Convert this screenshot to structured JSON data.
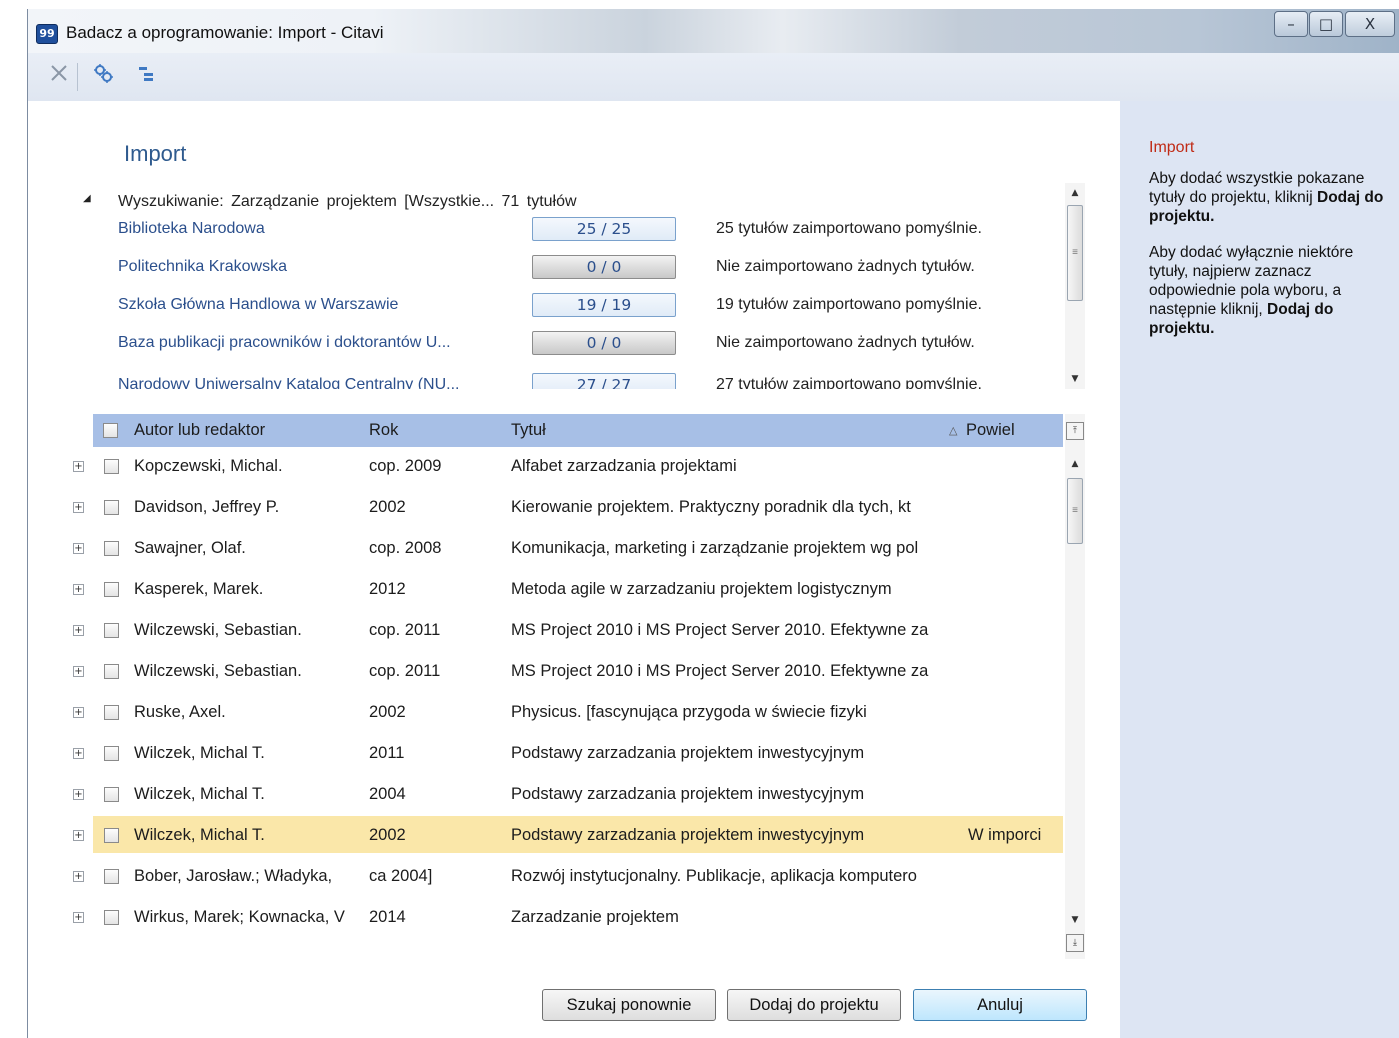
{
  "window": {
    "title": "Badacz a oprogramowanie: Import - Citavi",
    "app_icon_glyph": "99",
    "controls": {
      "minimize": "–",
      "maximize": "□",
      "close": "X"
    }
  },
  "toolbar": {
    "icons": [
      "close-x-icon",
      "gears-icon",
      "outline-icon"
    ]
  },
  "main": {
    "heading": "Import",
    "search": {
      "toggle_glyph": "◢",
      "label": "Wyszukiwanie: Zarządzanie projektem [Wszystkie... 71 tytułów"
    },
    "sources": [
      {
        "name": "Biblioteka Narodowa",
        "progress": "25 / 25",
        "status": "25 tytułów zaimportowano pomyślnie.",
        "ok": true
      },
      {
        "name": "Politechnika Krakowska",
        "progress": "0 / 0",
        "status": "Nie zaimportowano żadnych tytułów.",
        "ok": false
      },
      {
        "name": "Szkoła Główna Handlowa w Warszawie",
        "progress": "19 / 19",
        "status": "19 tytułów zaimportowano pomyślnie.",
        "ok": true
      },
      {
        "name": "Baza publikacji pracowników i doktorantów U...",
        "progress": "0 / 0",
        "status": "Nie zaimportowano żadnych tytułów.",
        "ok": false
      },
      {
        "name": "Narodowy Uniwersalny Katalog Centralny (NU...",
        "progress": "27 / 27",
        "status": "27 tytułów zaimportowano pomyślnie.",
        "ok": true
      }
    ],
    "grid": {
      "columns": {
        "author": "Autor lub redaktor",
        "year": "Rok",
        "title": "Tytuł",
        "duplicate": "Powiel",
        "sort_indicator": "△"
      },
      "rows": [
        {
          "author": "Kopczewski, Michal.",
          "year": "cop. 2009",
          "title": "Alfabet zarzadzania projektami",
          "duplicate": ""
        },
        {
          "author": "Davidson, Jeffrey P.",
          "year": "2002",
          "title": "Kierowanie projektem. Praktyczny poradnik dla tych, kt",
          "duplicate": ""
        },
        {
          "author": "Sawajner, Olaf.",
          "year": "cop. 2008",
          "title": "Komunikacja, marketing i zarządzanie projektem wg pol",
          "duplicate": ""
        },
        {
          "author": "Kasperek, Marek.",
          "year": "2012",
          "title": "Metoda agile w zarzadzaniu projektem logistycznym",
          "duplicate": ""
        },
        {
          "author": "Wilczewski, Sebastian.",
          "year": "cop. 2011",
          "title": "MS Project 2010 i MS Project Server 2010. Efektywne za",
          "duplicate": ""
        },
        {
          "author": "Wilczewski, Sebastian.",
          "year": "cop. 2011",
          "title": "MS Project 2010 i MS Project Server 2010. Efektywne za",
          "duplicate": ""
        },
        {
          "author": "Ruske, Axel.",
          "year": "2002",
          "title": "Physicus. [fascynująca przygoda w świecie fizyki",
          "duplicate": ""
        },
        {
          "author": "Wilczek, Michal T.",
          "year": "2011",
          "title": "Podstawy zarzadzania projektem inwestycyjnym",
          "duplicate": ""
        },
        {
          "author": "Wilczek, Michal T.",
          "year": "2004",
          "title": "Podstawy zarzadzania projektem inwestycyjnym",
          "duplicate": ""
        },
        {
          "author": "Wilczek, Michal T.",
          "year": "2002",
          "title": "Podstawy zarzadzania projektem inwestycyjnym",
          "duplicate": "W imporci",
          "highlighted": true
        },
        {
          "author": "Bober, Jarosław.; Władyka,",
          "year": "ca 2004]",
          "title": "Rozwój instytucjonalny. Publikacje, aplikacja komputero",
          "duplicate": ""
        },
        {
          "author": "Wirkus, Marek; Kownacka, V",
          "year": "2014",
          "title": "Zarzadzanie projektem",
          "duplicate": ""
        }
      ]
    },
    "buttons": {
      "search_again": "Szukaj ponownie",
      "add_to_project": "Dodaj do projektu",
      "cancel": "Anuluj"
    }
  },
  "help_panel": {
    "title": "Import",
    "p1_text": "Aby dodać wszystkie pokazane tytuły do projektu, kliknij ",
    "p1_bold": "Dodaj do projektu.",
    "p2_text": "Aby dodać wyłącznie niektóre tytuły, najpierw zaznacz odpowiednie pola wyboru, a następnie kliknij, ",
    "p2_bold": "Dodaj do projektu",
    "p2_end": "."
  },
  "colors": {
    "header_blue": "#a7bfe6",
    "highlight_row": "#fae7a9",
    "help_panel_bg": "#dde5f3",
    "help_title_red": "#c02b16",
    "link_blue": "#2b4f8c"
  }
}
